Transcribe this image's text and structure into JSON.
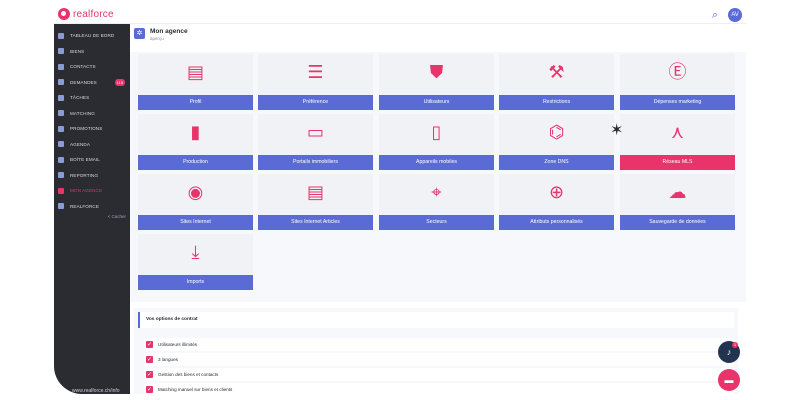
{
  "app": {
    "logo_text": "realforce",
    "avatar_initials": "AV"
  },
  "sidebar": {
    "items": [
      {
        "label": "TABLEAU DE BORD",
        "icon": "dashboard-icon"
      },
      {
        "label": "BIENS",
        "icon": "building-icon"
      },
      {
        "label": "CONTACTS",
        "icon": "contacts-icon"
      },
      {
        "label": "DEMANDES",
        "icon": "inbox-icon",
        "badge": "115"
      },
      {
        "label": "TÂCHES",
        "icon": "tasks-icon"
      },
      {
        "label": "MATCHING",
        "icon": "matching-icon"
      },
      {
        "label": "PROMOTIONS",
        "icon": "promotions-icon"
      },
      {
        "label": "AGENDA",
        "icon": "calendar-icon"
      },
      {
        "label": "BOÎTE EMAIL",
        "icon": "mail-icon"
      },
      {
        "label": "REPORTING",
        "icon": "reporting-icon"
      },
      {
        "label": "MON AGENCE",
        "icon": "agency-icon",
        "active": true
      },
      {
        "label": "REALFORCE",
        "icon": "realforce-icon"
      }
    ],
    "collapse_label": "< Cacher",
    "footer_url": "www.realforce.ch/info"
  },
  "page": {
    "title": "Mon agence",
    "subtitle": "aperçu"
  },
  "tiles": [
    {
      "label": "Profil",
      "icon": "document-icon",
      "glyph": "▤"
    },
    {
      "label": "Préférence",
      "icon": "sliders-icon",
      "glyph": "☰"
    },
    {
      "label": "Utilisateurs",
      "icon": "user-shield-icon",
      "glyph": "⛊"
    },
    {
      "label": "Restrictions",
      "icon": "gavel-icon",
      "glyph": "⚒"
    },
    {
      "label": "Dépenses marketing",
      "icon": "marketing-icon",
      "glyph": "Ⓔ"
    },
    {
      "label": "Production",
      "icon": "bar-chart-icon",
      "glyph": "▮"
    },
    {
      "label": "Portails immobiliers",
      "icon": "cast-icon",
      "glyph": "▭"
    },
    {
      "label": "Appareils mobiles",
      "icon": "mobile-settings-icon",
      "glyph": "▯"
    },
    {
      "label": "Zone DNS",
      "icon": "router-icon",
      "glyph": "⌬"
    },
    {
      "label": "Réseau MLS",
      "icon": "network-icon",
      "glyph": "⋏",
      "highlight": true
    },
    {
      "label": "Sites Internet",
      "icon": "globe-icon",
      "glyph": "◉"
    },
    {
      "label": "Sites Internet Articles",
      "icon": "article-icon",
      "glyph": "▤"
    },
    {
      "label": "Secteurs",
      "icon": "crosshair-icon",
      "glyph": "⌖"
    },
    {
      "label": "Attributs personnalisés",
      "icon": "plus-circle-icon",
      "glyph": "⊕"
    },
    {
      "label": "Sauvegarde de données",
      "icon": "cloud-download-icon",
      "glyph": "☁"
    },
    {
      "label": "Imports",
      "icon": "download-icon",
      "glyph": "⤓"
    }
  ],
  "options": {
    "title": "Vos options de contrat",
    "items": [
      "Utilisateurs illimités",
      "3 langues",
      "Gestion des biens et contacts",
      "Matching manuel sur biens et clients"
    ]
  },
  "fab": {
    "bell_badge": "1"
  },
  "colors": {
    "accent_pink": "#e8336b",
    "accent_blue": "#5b6bd6",
    "sidebar_bg": "#2a2c31"
  }
}
